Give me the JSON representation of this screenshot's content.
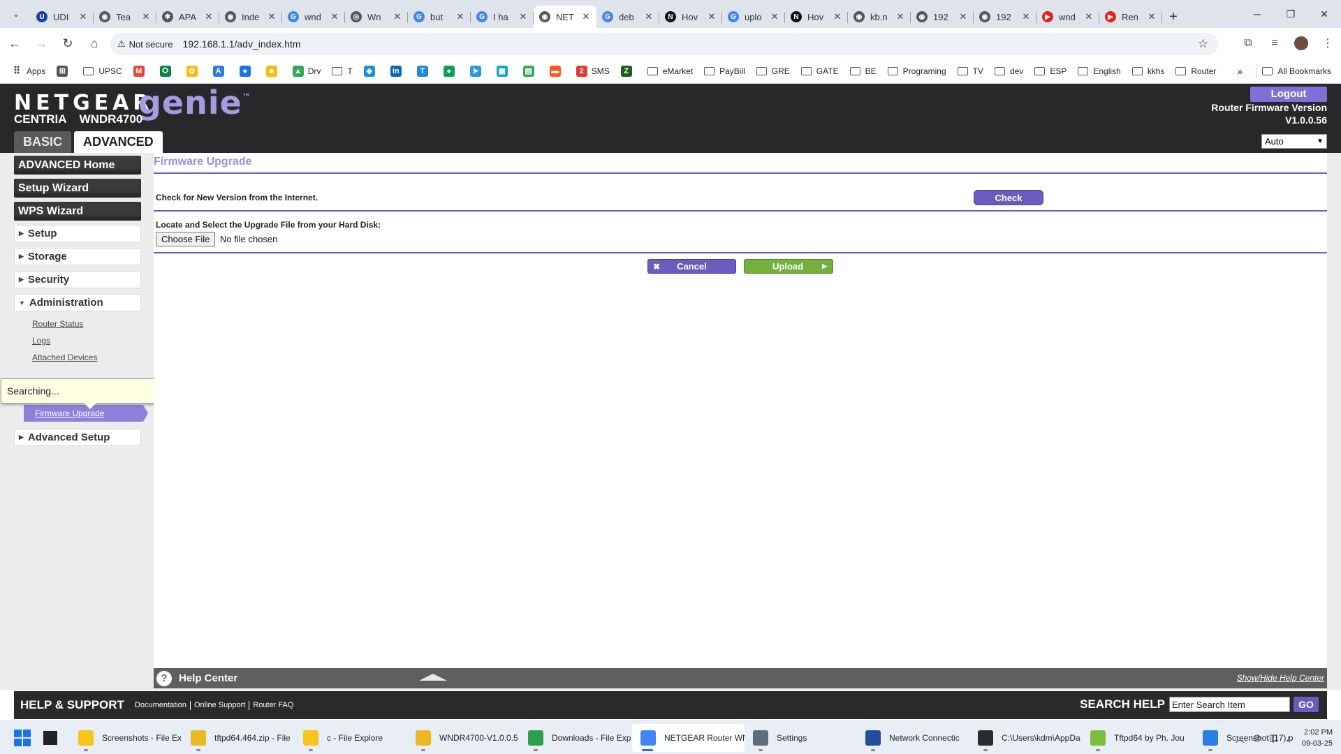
{
  "browser": {
    "tabs": [
      {
        "title": "UDI",
        "color": "#1a3fa8",
        "glyph": "U"
      },
      {
        "title": "Tea",
        "color": "#555555",
        "glyph": "◉"
      },
      {
        "title": "APA",
        "color": "#555555",
        "glyph": "✱"
      },
      {
        "title": "Inde",
        "color": "#555555",
        "glyph": "◉"
      },
      {
        "title": "wnd",
        "color": "#4285f4",
        "glyph": "G"
      },
      {
        "title": "Wn",
        "color": "#555555",
        "glyph": "◎"
      },
      {
        "title": "but",
        "color": "#4285f4",
        "glyph": "G"
      },
      {
        "title": "I ha",
        "color": "#4285f4",
        "glyph": "G"
      },
      {
        "title": "NET",
        "color": "#555555",
        "glyph": "◉",
        "active": true
      },
      {
        "title": "deb",
        "color": "#4285f4",
        "glyph": "G"
      },
      {
        "title": "Hov",
        "color": "#111111",
        "glyph": "N"
      },
      {
        "title": "uplo",
        "color": "#4285f4",
        "glyph": "G"
      },
      {
        "title": "Hov",
        "color": "#111111",
        "glyph": "N"
      },
      {
        "title": "kb.n",
        "color": "#555555",
        "glyph": "◉"
      },
      {
        "title": "192",
        "color": "#555555",
        "glyph": "◉"
      },
      {
        "title": "192",
        "color": "#555555",
        "glyph": "◉"
      },
      {
        "title": "wnd",
        "color": "#e62117",
        "glyph": "▶"
      },
      {
        "title": "Ren",
        "color": "#e62117",
        "glyph": "▶"
      }
    ],
    "security_label": "Not secure",
    "url": "192.168.1.1/adv_index.htm",
    "bookmarks": [
      {
        "label": "Apps",
        "type": "apps"
      },
      {
        "label": "",
        "type": "icon",
        "color": "#555555",
        "glyph": "⊞"
      },
      {
        "label": "UPSC",
        "type": "folder"
      },
      {
        "label": "",
        "type": "icon",
        "color": "#ea4335",
        "glyph": "M"
      },
      {
        "label": "",
        "type": "icon",
        "color": "#0b8043",
        "glyph": "⛭"
      },
      {
        "label": "",
        "type": "icon",
        "color": "#fbbc04",
        "glyph": "✿"
      },
      {
        "label": "",
        "type": "icon",
        "color": "#2d7be5",
        "glyph": "A"
      },
      {
        "label": "",
        "type": "icon",
        "color": "#1a73e8",
        "glyph": "●"
      },
      {
        "label": "",
        "type": "icon",
        "color": "#fbbc04",
        "glyph": "■"
      },
      {
        "label": "Drv",
        "type": "icon",
        "color": "#34a853",
        "glyph": "▲"
      },
      {
        "label": "T",
        "type": "folder"
      },
      {
        "label": "",
        "type": "icon",
        "color": "#1a8fd6",
        "glyph": "◆"
      },
      {
        "label": "",
        "type": "icon",
        "color": "#0a66c2",
        "glyph": "in"
      },
      {
        "label": "",
        "type": "icon",
        "color": "#1e88e5",
        "glyph": "T"
      },
      {
        "label": "",
        "type": "icon",
        "color": "#0f9d58",
        "glyph": "●"
      },
      {
        "label": "",
        "type": "icon",
        "color": "#229ed9",
        "glyph": "➤"
      },
      {
        "label": "",
        "type": "icon",
        "color": "#17a2b8",
        "glyph": "▣"
      },
      {
        "label": "",
        "type": "icon",
        "color": "#34a853",
        "glyph": "▤"
      },
      {
        "label": "",
        "type": "icon",
        "color": "#ff5722",
        "glyph": "▬"
      },
      {
        "label": "SMS",
        "type": "icon",
        "color": "#e53935",
        "glyph": "2"
      },
      {
        "label": "",
        "type": "icon",
        "color": "#1b5e20",
        "glyph": "Z"
      },
      {
        "label": "eMarket",
        "type": "folder"
      },
      {
        "label": "PayBill",
        "type": "folder"
      },
      {
        "label": "GRE",
        "type": "folder"
      },
      {
        "label": "GATE",
        "type": "folder"
      },
      {
        "label": "BE",
        "type": "folder"
      },
      {
        "label": "Programing",
        "type": "folder"
      },
      {
        "label": "TV",
        "type": "folder"
      },
      {
        "label": "dev",
        "type": "folder"
      },
      {
        "label": "ESP",
        "type": "folder"
      },
      {
        "label": "English",
        "type": "folder"
      },
      {
        "label": "kkhs",
        "type": "folder"
      },
      {
        "label": "Router",
        "type": "folder"
      }
    ],
    "all_bookmarks_label": "All Bookmarks"
  },
  "router": {
    "brand": "NETGEAR",
    "product": "genie",
    "series": "CENTRIA",
    "model": "WNDR4700",
    "logout_label": "Logout",
    "fw_label": "Router Firmware Version",
    "fw_version": "V1.0.0.56",
    "language_value": "Auto",
    "tabs": {
      "basic": "BASIC",
      "advanced": "ADVANCED"
    }
  },
  "sidebar": {
    "top_items": [
      "ADVANCED Home",
      "Setup Wizard",
      "WPS Wizard"
    ],
    "sections": [
      "Setup",
      "Storage",
      "Security",
      "Administration"
    ],
    "admin_items": [
      "Router Status",
      "Logs",
      "Attached Devices"
    ],
    "active_item": "Firmware Upgrade",
    "last_section": "Advanced Setup"
  },
  "tooltip": {
    "text": "Searching..."
  },
  "main": {
    "title": "Firmware Upgrade",
    "check_label": "Check for New Version from the Internet.",
    "check_button": "Check",
    "locate_label": "Locate and  Select the Upgrade File from your Hard Disk:",
    "choose_file_button": "Choose File",
    "file_status": "No file chosen",
    "cancel_button": "Cancel",
    "upload_button": "Upload"
  },
  "help": {
    "title": "Help Center",
    "show_hide": "Show/Hide Help Center"
  },
  "footer": {
    "title": "HELP & SUPPORT",
    "links": [
      "Documentation",
      "Online Support",
      "Router FAQ"
    ],
    "search_label": "SEARCH HELP",
    "search_placeholder": "Enter Search Item",
    "go_button": "GO"
  },
  "taskbar": {
    "apps": [
      {
        "label": "Screenshots - File Ex",
        "color": "#f5c518"
      },
      {
        "label": "tftpd64.464.zip - File",
        "color": "#e8b923"
      },
      {
        "label": "c - File Explore",
        "color": "#f5c518"
      },
      {
        "label": "WNDR4700-V1.0.0.5",
        "color": "#e8b923"
      },
      {
        "label": "Downloads - File Exp",
        "color": "#2e9e4f"
      },
      {
        "label": "NETGEAR Router WN",
        "color": "#4285f4",
        "active": true
      },
      {
        "label": "Settings",
        "color": "#5f6b7a"
      },
      {
        "label": "Network Connectic",
        "color": "#1f4e9e"
      },
      {
        "label": "C:\\Users\\kdm\\AppDa",
        "color": "#2b2b2b"
      },
      {
        "label": "Tftpd64 by Ph. Jou",
        "color": "#7cbf3f"
      },
      {
        "label": "Screenshot (17).p",
        "color": "#2a7de1"
      }
    ],
    "time": "2:02 PM",
    "date": "09-03-25"
  }
}
